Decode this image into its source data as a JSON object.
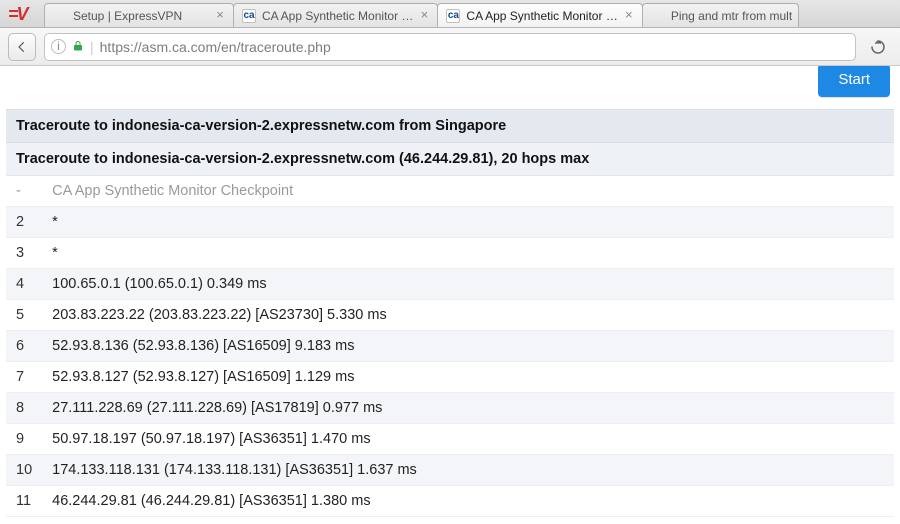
{
  "browser": {
    "menu_icon_text": "=V",
    "tabs": [
      {
        "label": "Setup | ExpressVPN",
        "favicon": "",
        "active": false,
        "closable": true
      },
      {
        "label": "CA App Synthetic Monitor …",
        "favicon": "ca",
        "active": false,
        "closable": true
      },
      {
        "label": "CA App Synthetic Monitor …",
        "favicon": "ca",
        "active": true,
        "closable": true
      },
      {
        "label": "Ping and mtr from mult",
        "favicon": "",
        "active": false,
        "closable": false
      }
    ],
    "url": "https://asm.ca.com/en/traceroute.php"
  },
  "page": {
    "start_button": "Start",
    "header": "Traceroute to indonesia-ca-version-2.expressnetw.com from Singapore",
    "subheader": "Traceroute to indonesia-ca-version-2.expressnetw.com (46.244.29.81), 20 hops max",
    "hops": [
      {
        "n": "-",
        "text": "CA App Synthetic Monitor Checkpoint",
        "muted": true
      },
      {
        "n": "2",
        "text": "*"
      },
      {
        "n": "3",
        "text": "*"
      },
      {
        "n": "4",
        "text": "100.65.0.1 (100.65.0.1) 0.349 ms"
      },
      {
        "n": "5",
        "text": "203.83.223.22 (203.83.223.22) [AS23730] 5.330 ms"
      },
      {
        "n": "6",
        "text": "52.93.8.136 (52.93.8.136) [AS16509] 9.183 ms"
      },
      {
        "n": "7",
        "text": "52.93.8.127 (52.93.8.127) [AS16509] 1.129 ms"
      },
      {
        "n": "8",
        "text": "27.111.228.69 (27.111.228.69) [AS17819] 0.977 ms"
      },
      {
        "n": "9",
        "text": "50.97.18.197 (50.97.18.197) [AS36351] 1.470 ms"
      },
      {
        "n": "10",
        "text": "174.133.118.131 (174.133.118.131) [AS36351] 1.637 ms"
      },
      {
        "n": "11",
        "text": "46.244.29.81 (46.244.29.81) [AS36351] 1.380 ms"
      }
    ]
  }
}
